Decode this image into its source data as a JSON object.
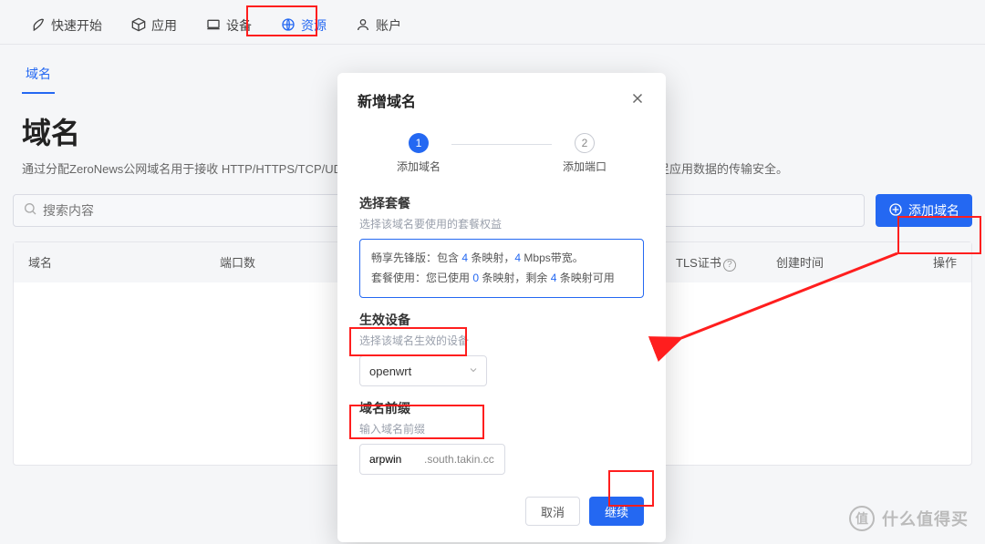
{
  "nav": {
    "items": [
      {
        "label": "快速开始",
        "icon": "rocket"
      },
      {
        "label": "应用",
        "icon": "cube"
      },
      {
        "label": "设备",
        "icon": "laptop"
      },
      {
        "label": "资源",
        "icon": "globe",
        "active": true
      },
      {
        "label": "账户",
        "icon": "user"
      }
    ]
  },
  "sub_tab": {
    "label": "域名"
  },
  "title": "域名",
  "desc": "通过分配ZeroNews公网域名用于接收 HTTP/HTTPS/TCP/UDP的                                                                                  HTTPS访问请求，由ZeroNews统一分配TLS证书，以满足应用数据的传输安全。",
  "search": {
    "placeholder": "搜索内容"
  },
  "add_button": {
    "label": "添加域名"
  },
  "columns": [
    {
      "key": "domain",
      "label": "域名"
    },
    {
      "key": "ports",
      "label": "端口数"
    },
    {
      "key": "tls",
      "label": "TLS证书",
      "q": true
    },
    {
      "key": "created",
      "label": "创建时间"
    },
    {
      "key": "op",
      "label": "操作"
    }
  ],
  "modal": {
    "title": "新增域名",
    "step1": "添加域名",
    "step2": "添加端口",
    "plan_title": "选择套餐",
    "plan_sub": "选择该域名要使用的套餐权益",
    "plan_line1_a": "畅享先锋版：包含 ",
    "plan_line1_b": " 条映射，",
    "plan_line1_c": " Mbps带宽。",
    "plan_val1": "4",
    "plan_val2": "4",
    "plan_line2_a": "套餐使用：您已使用 ",
    "plan_line2_b": " 条映射，剩余 ",
    "plan_line2_c": " 条映射可用",
    "plan_used": "0",
    "plan_left": "4",
    "device_title": "生效设备",
    "device_sub": "选择该域名生效的设备",
    "device_value": "openwrt",
    "prefix_title": "域名前缀",
    "prefix_sub": "输入域名前缀",
    "prefix_value": "arpwin",
    "prefix_suffix": ".south.takin.cc",
    "cancel": "取消",
    "continue": "继续"
  },
  "watermark": "什么值得买"
}
